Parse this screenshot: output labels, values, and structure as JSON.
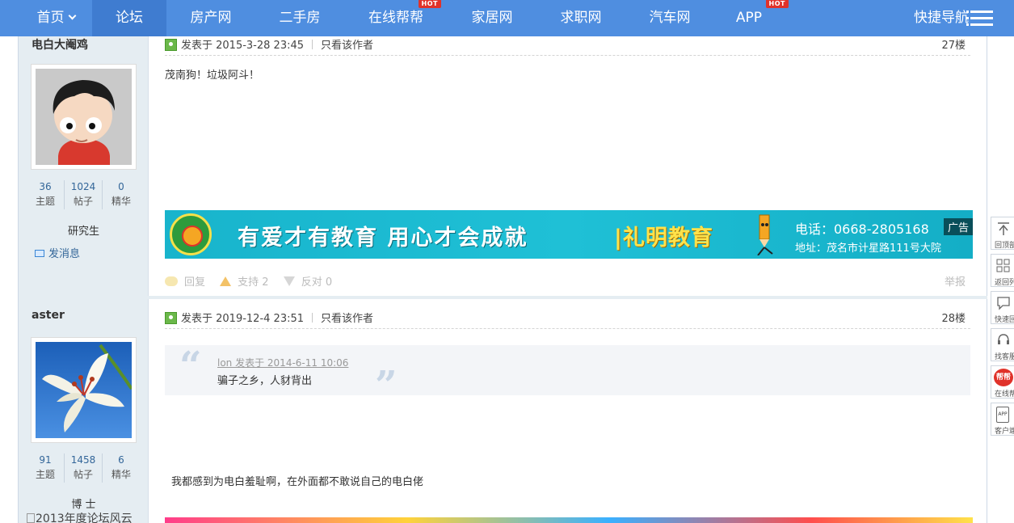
{
  "nav": {
    "items": [
      {
        "label": "首页",
        "hot": false
      },
      {
        "label": "论坛",
        "hot": false
      },
      {
        "label": "房产网",
        "hot": false
      },
      {
        "label": "二手房",
        "hot": false
      },
      {
        "label": "在线帮帮",
        "hot": true
      },
      {
        "label": "家居网",
        "hot": false
      },
      {
        "label": "求职网",
        "hot": false
      },
      {
        "label": "汽车网",
        "hot": false
      },
      {
        "label": "APP",
        "hot": true
      }
    ],
    "hot_badge": "HOT",
    "quick_nav": "快捷导航"
  },
  "posts": [
    {
      "author": "电白大阉鸡",
      "stats": [
        {
          "num": "36",
          "label": "主题"
        },
        {
          "num": "1024",
          "label": "帖子"
        },
        {
          "num": "0",
          "label": "精华"
        }
      ],
      "rank": "研究生",
      "send_message": "发消息",
      "posted_at": "发表于 2015-3-28 23:45",
      "only_author": "只看该作者",
      "floor": "27楼",
      "content": "茂南狗！垃圾阿斗！",
      "ad": {
        "slogan": "有爱才有教育 用心才会成就",
        "brand": "|礼明教育",
        "phone": "电话：0668-2805168",
        "address": "地址：茂名市计星路111号大院",
        "tag": "广告"
      },
      "actions": {
        "reply": "回复",
        "support": "支持 2",
        "oppose": "反对 0",
        "report": "举报"
      }
    },
    {
      "author": "aster",
      "stats": [
        {
          "num": "91",
          "label": "主题"
        },
        {
          "num": "1458",
          "label": "帖子"
        },
        {
          "num": "6",
          "label": "精华"
        }
      ],
      "rank": "博 士",
      "medal_alt": "2013年度论坛风云",
      "posted_at": "发表于 2019-12-4 23:51",
      "only_author": "只看该作者",
      "floor": "28楼",
      "quote": {
        "header": "lon 发表于 2014-6-11 10:06",
        "text": "骗子之乡，人豺背出"
      },
      "content": "我都感到为电白羞耻啊，在外面都不敢说自己的电白佬"
    }
  ],
  "right_tools": [
    {
      "label": "回顶部",
      "icon": "arrow-up-icon"
    },
    {
      "label": "返回列表",
      "icon": "grid-list-icon"
    },
    {
      "label": "快速回复",
      "icon": "chat-bubble-icon"
    },
    {
      "label": "找客服",
      "icon": "headset-icon"
    },
    {
      "label": "在线帮帮",
      "icon": "bangbang-icon",
      "badge": "帮帮"
    },
    {
      "label": "客户端",
      "icon": "app-icon",
      "badge": "APP"
    }
  ]
}
